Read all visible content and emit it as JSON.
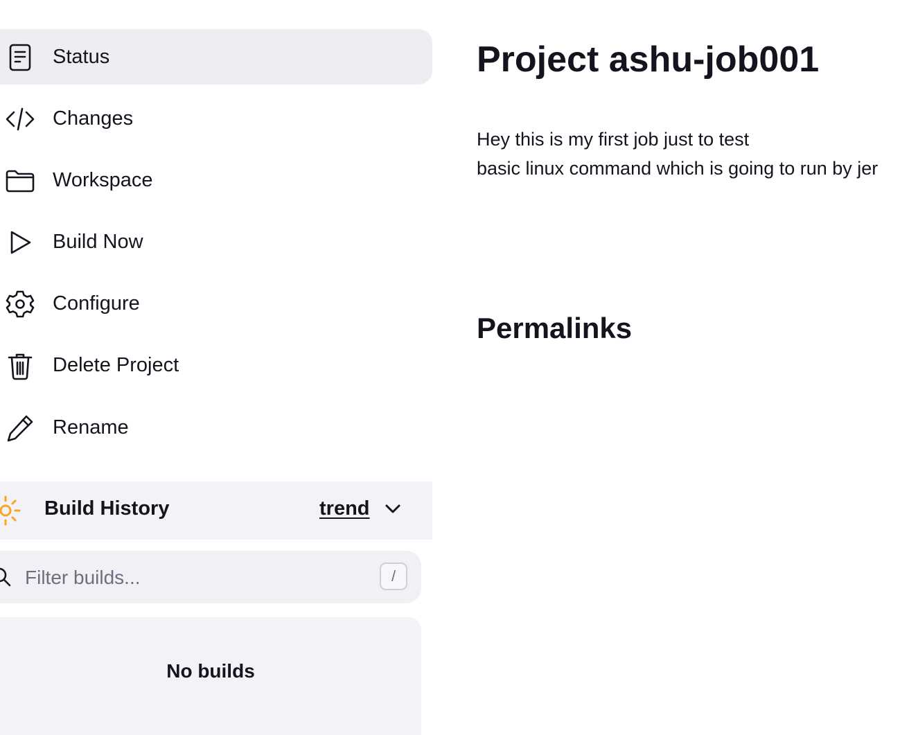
{
  "sidebar": {
    "items": [
      {
        "label": "Status",
        "icon": "document-icon",
        "active": true
      },
      {
        "label": "Changes",
        "icon": "code-icon"
      },
      {
        "label": "Workspace",
        "icon": "folder-icon"
      },
      {
        "label": "Build Now",
        "icon": "play-icon"
      },
      {
        "label": "Configure",
        "icon": "gear-icon"
      },
      {
        "label": "Delete Project",
        "icon": "trash-icon"
      },
      {
        "label": "Rename",
        "icon": "pencil-icon"
      }
    ]
  },
  "build_history": {
    "title": "Build History",
    "trend_label": "trend",
    "filter_placeholder": "Filter builds...",
    "shortcut_key": "/",
    "empty_message": "No builds",
    "status_icon": "sun-icon",
    "status_color": "#f5a623"
  },
  "main": {
    "title": "Project ashu-job001",
    "description_lines": [
      "Hey this is my first job just to test",
      "basic linux command which is going to run by jer"
    ],
    "permalinks_heading": "Permalinks"
  },
  "colors": {
    "active_bg": "#ededf2",
    "panel_bg": "#f3f3f7",
    "text": "#14141f",
    "muted": "#6e6e80"
  }
}
